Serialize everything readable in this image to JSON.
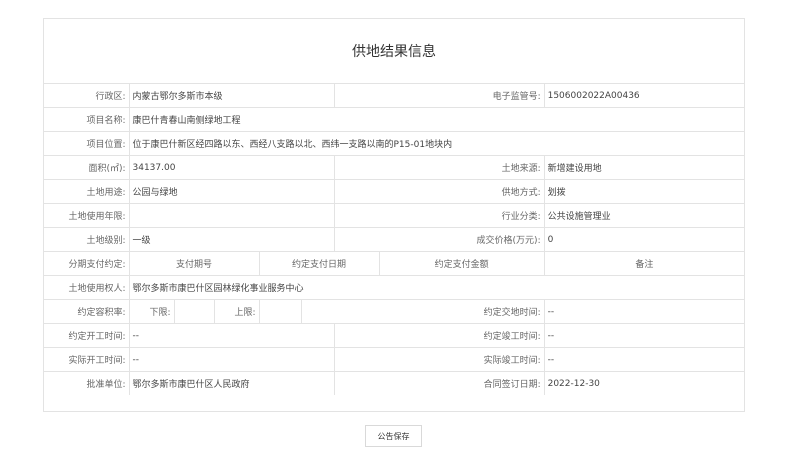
{
  "title": "供地结果信息",
  "fields": {
    "district_label": "行政区:",
    "district_value": "内蒙古鄂尔多斯市本级",
    "e_supervision_label": "电子监管号:",
    "e_supervision_value": "1506002022A00436",
    "project_name_label": "项目名称:",
    "project_name_value": "康巴什青春山南侧绿地工程",
    "project_location_label": "项目位置:",
    "project_location_value": "位于康巴什新区经四路以东、西经八支路以北、西纬一支路以南的P15-01地块内",
    "area_label": "面积(㎡):",
    "area_value": "34137.00",
    "land_source_label": "土地来源:",
    "land_source_value": "新增建设用地",
    "land_use_label": "土地用途:",
    "land_use_value": "公园与绿地",
    "supply_method_label": "供地方式:",
    "supply_method_value": "划拨",
    "use_term_label": "土地使用年限:",
    "use_term_value": "",
    "industry_label": "行业分类:",
    "industry_value": "公共设施管理业",
    "land_grade_label": "土地级别:",
    "land_grade_value": "一级",
    "price_label": "成交价格(万元):",
    "price_value": "0",
    "installment_label": "分期支付约定:",
    "installment_headers": [
      "支付期号",
      "约定支付日期",
      "约定支付金额",
      "备注"
    ],
    "land_user_label": "土地使用权人:",
    "land_user_value": "鄂尔多斯市康巴什区园林绿化事业服务中心",
    "far_label": "约定容积率:",
    "far_lower_label": "下限:",
    "far_lower_value": "",
    "far_upper_label": "上限:",
    "far_upper_value": "",
    "delivery_time_label": "约定交地时间:",
    "delivery_time_value": "--",
    "agreed_start_label": "约定开工时间:",
    "agreed_start_value": "--",
    "agreed_completion_label": "约定竣工时间:",
    "agreed_completion_value": "--",
    "actual_start_label": "实际开工时间:",
    "actual_start_value": "--",
    "actual_completion_label": "实际竣工时间:",
    "actual_completion_value": "--",
    "approval_label": "批准单位:",
    "approval_value": "鄂尔多斯市康巴什区人民政府",
    "contract_date_label": "合同签订日期:",
    "contract_date_value": "2022-12-30"
  },
  "save_button": "公告保存"
}
